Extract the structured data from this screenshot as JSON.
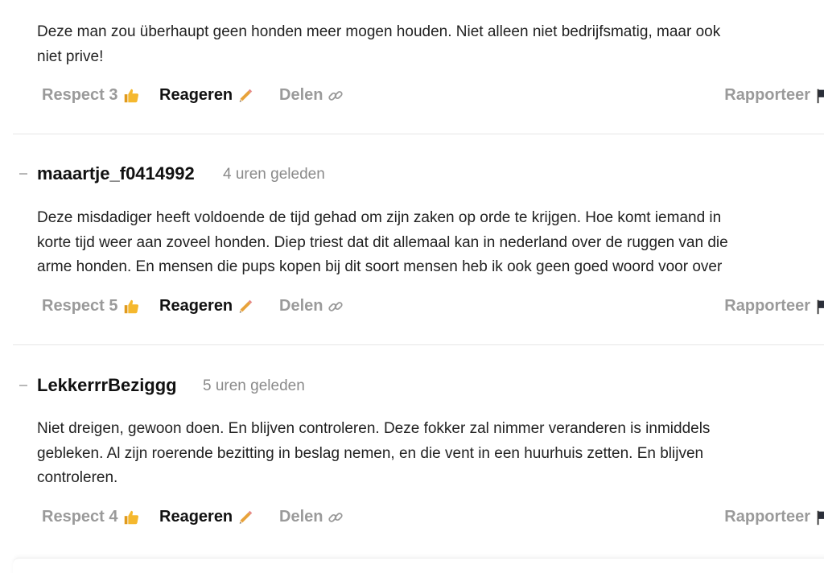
{
  "comments": [
    {
      "username": "",
      "timestamp": "",
      "body_lines": [
        "Deze man zou überhaupt geen honden meer mogen houden. Niet alleen niet bedrijfsmatig, maar ook",
        "niet prive!"
      ],
      "actions": {
        "respect_label": "Respect 3",
        "reply_label": "Reageren",
        "share_label": "Delen",
        "report_label": "Rapporteer"
      }
    },
    {
      "username": "maaartje_f0414992",
      "timestamp": "4 uren geleden",
      "body_lines": [
        "Deze misdadiger heeft voldoende de tijd gehad om zijn zaken op orde te krijgen. Hoe komt iemand in",
        "korte tijd weer aan zoveel honden. Diep triest dat dit allemaal kan in nederland over de ruggen van die",
        "arme honden. En mensen die pups kopen bij dit soort mensen heb ik ook geen goed woord voor over"
      ],
      "actions": {
        "respect_label": "Respect 5",
        "reply_label": "Reageren",
        "share_label": "Delen",
        "report_label": "Rapporteer"
      }
    },
    {
      "username": "LekkerrrBeziggg",
      "timestamp": "5 uren geleden",
      "body_lines": [
        "Niet dreigen, gewoon doen. En blijven controleren. Deze fokker zal nimmer veranderen is inmiddels",
        "gebleken. Al zijn roerende bezitting in beslag nemen, en die vent in een huurhuis zetten. En blijven",
        "controleren."
      ],
      "actions": {
        "respect_label": "Respect 4",
        "reply_label": "Reageren",
        "share_label": "Delen",
        "report_label": "Rapporteer"
      }
    }
  ],
  "icons": {
    "respect": "thumbs-up-icon",
    "reply": "pencil-icon",
    "share": "link-icon",
    "report": "flag-icon"
  },
  "colors": {
    "username": "#111111",
    "muted": "#9a9a9a",
    "body_text": "#222222",
    "divider": "#e6e6e6",
    "thumb": "#f5b82e",
    "pencil": "#e8a23a"
  }
}
